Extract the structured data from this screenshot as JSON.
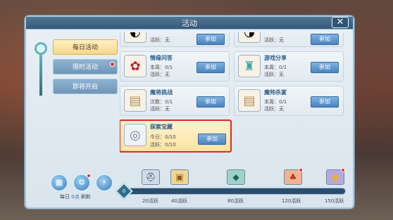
{
  "window": {
    "title": "活动",
    "close_glyph": "✕"
  },
  "tabs": [
    {
      "label": "每日活动",
      "active": true
    },
    {
      "label": "限时活动",
      "active": false,
      "badge": true
    },
    {
      "label": "即将开启",
      "active": false
    }
  ],
  "cards": [
    {
      "name": "",
      "line1": "",
      "line2": "活跃：无",
      "button": "参加",
      "icon": "top-partial-icon-left"
    },
    {
      "name": "",
      "line1": "",
      "line2": "活跃：无",
      "button": "参加",
      "icon": "top-partial-icon-right"
    },
    {
      "name": "情缘问答",
      "line1": "本周：0/1",
      "line2": "活跃：无",
      "button": "参加",
      "icon": "rose-icon"
    },
    {
      "name": "游戏分享",
      "line1": "本周：0/1",
      "line2": "活跃：无",
      "button": "参加",
      "icon": "robe-icon"
    },
    {
      "name": "魔将挑战",
      "line1": "次数：0/1",
      "line2": "活跃：无",
      "button": "参加",
      "icon": "scroll-icon"
    },
    {
      "name": "魔帅杀宴",
      "line1": "本周：0/1",
      "line2": "活跃：无",
      "button": "参加",
      "icon": "scroll-icon"
    },
    {
      "name": "探索宝藏",
      "line1": "今日：0/10",
      "line2": "活跃：0/10",
      "button": "参加",
      "icon": "compass-icon",
      "highlight": true
    }
  ],
  "bottom": {
    "refresh_prefix": "每日",
    "refresh_value": "0点",
    "refresh_suffix": "刷新",
    "progress_value": "0",
    "milestones": [
      {
        "label": "20活跃",
        "icon": "helmet-chest-icon"
      },
      {
        "label": "40活跃",
        "icon": "gold-chest-icon"
      },
      {
        "label": "80活跃",
        "icon": "jade-chest-icon"
      },
      {
        "label": "120活跃",
        "icon": "red-bag-icon"
      },
      {
        "label": "150活跃",
        "icon": "gold-coin-icon"
      }
    ]
  },
  "colors": {
    "accent": "#4a84bf",
    "highlight_border": "#e02a2a",
    "active_tab": "#f6d68a"
  }
}
